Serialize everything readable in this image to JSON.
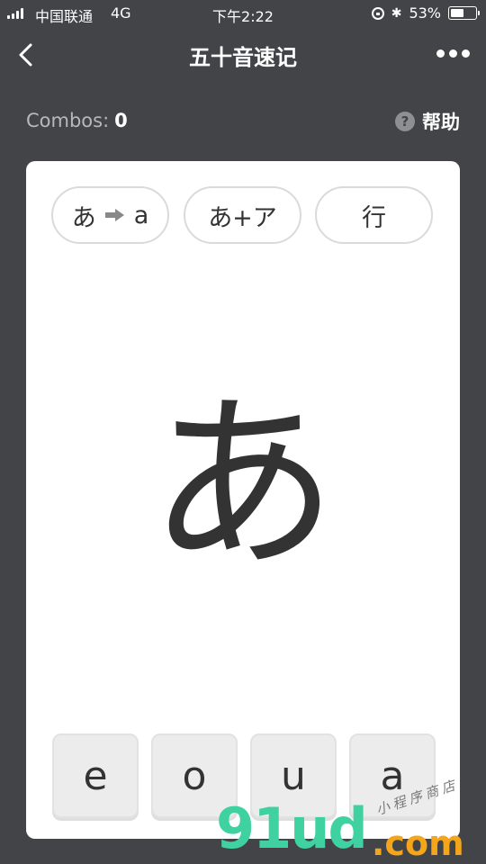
{
  "status_bar": {
    "carrier": "中国联通",
    "network": "4G",
    "time": "下午2:22",
    "battery": "53%",
    "battery_level": 0.53
  },
  "nav": {
    "title": "五十音速记"
  },
  "combos": {
    "label": "Combos:",
    "value": "0"
  },
  "help": {
    "icon_text": "?",
    "label": "帮助"
  },
  "modes": [
    {
      "left": "あ",
      "right": "a"
    },
    {
      "label": "あ+ア"
    },
    {
      "label": "行"
    }
  ],
  "kana": "あ",
  "answers": [
    "e",
    "o",
    "u",
    "a"
  ],
  "watermark": {
    "logo": "91ud",
    "domain": ".com",
    "tagline": "小程序商店"
  },
  "colors": {
    "background": "#434447",
    "card": "#ffffff",
    "watermark_green": "#3fd1a0",
    "watermark_orange": "#f4a51a"
  }
}
